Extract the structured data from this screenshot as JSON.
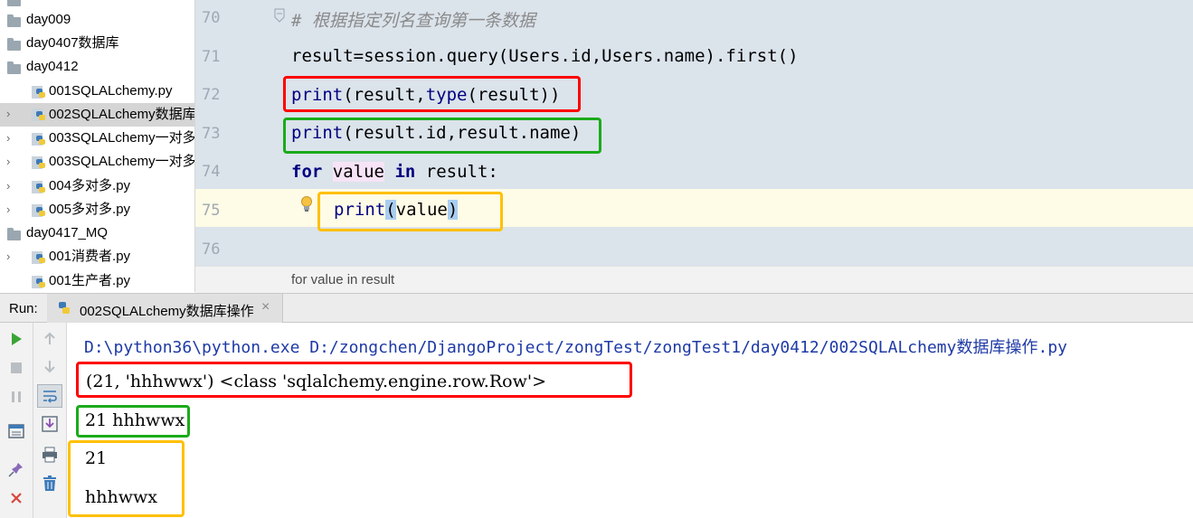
{
  "project_tree": {
    "items": [
      {
        "label": "day009",
        "kind": "folder"
      },
      {
        "label": "day0407数据库",
        "kind": "folder"
      },
      {
        "label": "day0412",
        "kind": "folder"
      },
      {
        "label": "001SQLALchemy.py",
        "kind": "python-file"
      },
      {
        "label": "002SQLALchemy数据库",
        "kind": "python-file"
      },
      {
        "label": "003SQLALchemy一对多",
        "kind": "python-file"
      },
      {
        "label": "003SQLALchemy一对多",
        "kind": "python-file"
      },
      {
        "label": "004多对多.py",
        "kind": "python-file"
      },
      {
        "label": "005多对多.py",
        "kind": "python-file"
      },
      {
        "label": "day0417_MQ",
        "kind": "folder"
      },
      {
        "label": "001消费者.py",
        "kind": "python-file"
      },
      {
        "label": "001生产者.py",
        "kind": "python-file"
      }
    ]
  },
  "editor": {
    "line_numbers": [
      "70",
      "71",
      "72",
      "73",
      "74",
      "75",
      "76"
    ],
    "lines": {
      "l70_comment": "# 根据指定列名查询第一条数据",
      "l71": "result=session.query(Users.id,Users.name).first()",
      "l72_fn": "print",
      "l72_a": "(result,",
      "l72_fn2": "type",
      "l72_b": "(result))",
      "l73_fn": "print",
      "l73_a": "(result.id,result.name)",
      "l74_kw1": "for",
      "l74_var": "value",
      "l74_kw2": "in",
      "l74_rest": "result:",
      "l75_fn": "print",
      "l75_open": "(",
      "l75_arg": "value",
      "l75_close": ")"
    },
    "breadcrumb": "for value in result"
  },
  "run": {
    "label": "Run:",
    "tab_label": "002SQLALchemy数据库操作",
    "close_icon": "×",
    "output": {
      "command": "D:\\python36\\python.exe D:/zongchen/DjangoProject/zongTest/zongTest1/day0412/002SQLALchemy数据库操作.py",
      "line1": "(21, 'hhhwwx') <class 'sqlalchemy.engine.row.Row'>",
      "line2": "21 hhhwwx",
      "line3": "21",
      "line4": "hhhwwx"
    }
  },
  "colors": {
    "annotation_red": "#ff0000",
    "annotation_green": "#1aab1a",
    "annotation_yellow": "#ffc000",
    "editor_bg": "#dbe3eb",
    "current_line_bg": "#fefbe6"
  }
}
